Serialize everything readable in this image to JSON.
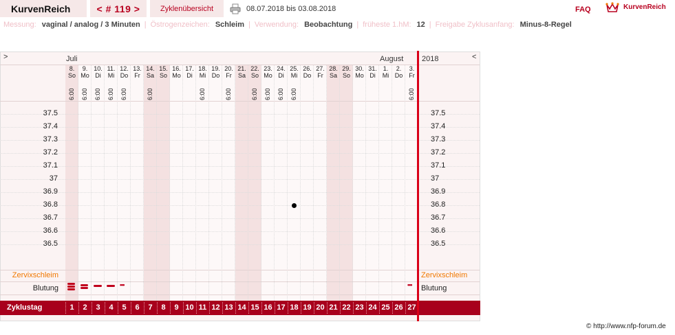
{
  "header": {
    "brand": "KurvenReich",
    "nav_prev": "<",
    "cycle_no": "# 119",
    "nav_next": ">",
    "overview": "Zyklenübersicht",
    "date_range": "08.07.2018 bis 03.08.2018",
    "faq": "FAQ",
    "logo_text": "KurvenReich"
  },
  "info": {
    "measure_label": "Messung:",
    "measure_value": "vaginal / analog / 3 Minuten",
    "estrogen_label": "Östrogenzeichen:",
    "estrogen_value": "Schleim",
    "usage_label": "Verwendung:",
    "usage_value": "Beobachtung",
    "earliest_label": "früheste 1.hM:",
    "earliest_value": "12",
    "release_label": "Freigabe Zyklusanfang:",
    "release_value": "Minus-8-Regel"
  },
  "chart": {
    "arrow_left": ">",
    "arrow_right": "<",
    "month1": "Juli",
    "month2": "August",
    "year": "2018",
    "y_ticks": [
      "37.5",
      "37.4",
      "37.3",
      "37.2",
      "37.1",
      "37",
      "36.9",
      "36.8",
      "36.7",
      "36.6",
      "36.5"
    ],
    "cervix_label": "Zervixschleim",
    "bleeding_label": "Blutung",
    "cycle_day_label": "Zyklustag",
    "footer": "© http://www.nfp-forum.de"
  },
  "chart_data": {
    "type": "scatter",
    "ylim": [
      36.4,
      37.6
    ],
    "days": [
      {
        "date": "8.",
        "dow": "So",
        "time": "6:00",
        "weekend": true
      },
      {
        "date": "9.",
        "dow": "Mo",
        "time": "6:00",
        "weekend": false
      },
      {
        "date": "10.",
        "dow": "Di",
        "time": "6:00",
        "weekend": false
      },
      {
        "date": "11.",
        "dow": "Mi",
        "time": "6:00",
        "weekend": false
      },
      {
        "date": "12.",
        "dow": "Do",
        "time": "6:00",
        "weekend": false
      },
      {
        "date": "13.",
        "dow": "Fr",
        "time": "",
        "weekend": false
      },
      {
        "date": "14.",
        "dow": "Sa",
        "time": "6:00",
        "weekend": true
      },
      {
        "date": "15.",
        "dow": "So",
        "time": "",
        "weekend": true
      },
      {
        "date": "16.",
        "dow": "Mo",
        "time": "",
        "weekend": false
      },
      {
        "date": "17.",
        "dow": "Di",
        "time": "",
        "weekend": false
      },
      {
        "date": "18.",
        "dow": "Mi",
        "time": "6:00",
        "weekend": false
      },
      {
        "date": "19.",
        "dow": "Do",
        "time": "",
        "weekend": false
      },
      {
        "date": "20.",
        "dow": "Fr",
        "time": "6:00",
        "weekend": false
      },
      {
        "date": "21.",
        "dow": "Sa",
        "time": "",
        "weekend": true
      },
      {
        "date": "22.",
        "dow": "So",
        "time": "6:00",
        "weekend": true
      },
      {
        "date": "23.",
        "dow": "Mo",
        "time": "6:00",
        "weekend": false
      },
      {
        "date": "24.",
        "dow": "Di",
        "time": "6:00",
        "weekend": false
      },
      {
        "date": "25.",
        "dow": "Mi",
        "time": "6:00",
        "weekend": false
      },
      {
        "date": "26.",
        "dow": "Do",
        "time": "",
        "weekend": false
      },
      {
        "date": "27.",
        "dow": "Fr",
        "time": "",
        "weekend": false
      },
      {
        "date": "28.",
        "dow": "Sa",
        "time": "",
        "weekend": true
      },
      {
        "date": "29.",
        "dow": "So",
        "time": "",
        "weekend": true
      },
      {
        "date": "30.",
        "dow": "Mo",
        "time": "",
        "weekend": false
      },
      {
        "date": "31.",
        "dow": "Di",
        "time": "",
        "weekend": false
      },
      {
        "date": "1.",
        "dow": "Mi",
        "time": "",
        "weekend": false
      },
      {
        "date": "2.",
        "dow": "Do",
        "time": "",
        "weekend": false
      },
      {
        "date": "3.",
        "dow": "Fr",
        "time": "6:00",
        "weekend": false
      }
    ],
    "cycle_days": [
      "1",
      "2",
      "3",
      "4",
      "5",
      "6",
      "7",
      "8",
      "9",
      "10",
      "11",
      "12",
      "13",
      "14",
      "15",
      "16",
      "17",
      "18",
      "19",
      "20",
      "21",
      "22",
      "23",
      "24",
      "25",
      "26",
      "27"
    ],
    "temperatures": [
      {
        "cycle_day": 18,
        "value": 36.8
      }
    ],
    "bleeding": [
      {
        "cycle_day": 1,
        "level": "heavy"
      },
      {
        "cycle_day": 2,
        "level": "medium"
      },
      {
        "cycle_day": 3,
        "level": "normal"
      },
      {
        "cycle_day": 4,
        "level": "normal"
      },
      {
        "cycle_day": 5,
        "level": "spotting"
      },
      {
        "cycle_day": 27,
        "level": "spotting"
      }
    ],
    "colors": {
      "accent": "#b8001f",
      "cycle_bar": "#a8001c",
      "divider": "#d90018",
      "cervix": "#f07800"
    }
  }
}
